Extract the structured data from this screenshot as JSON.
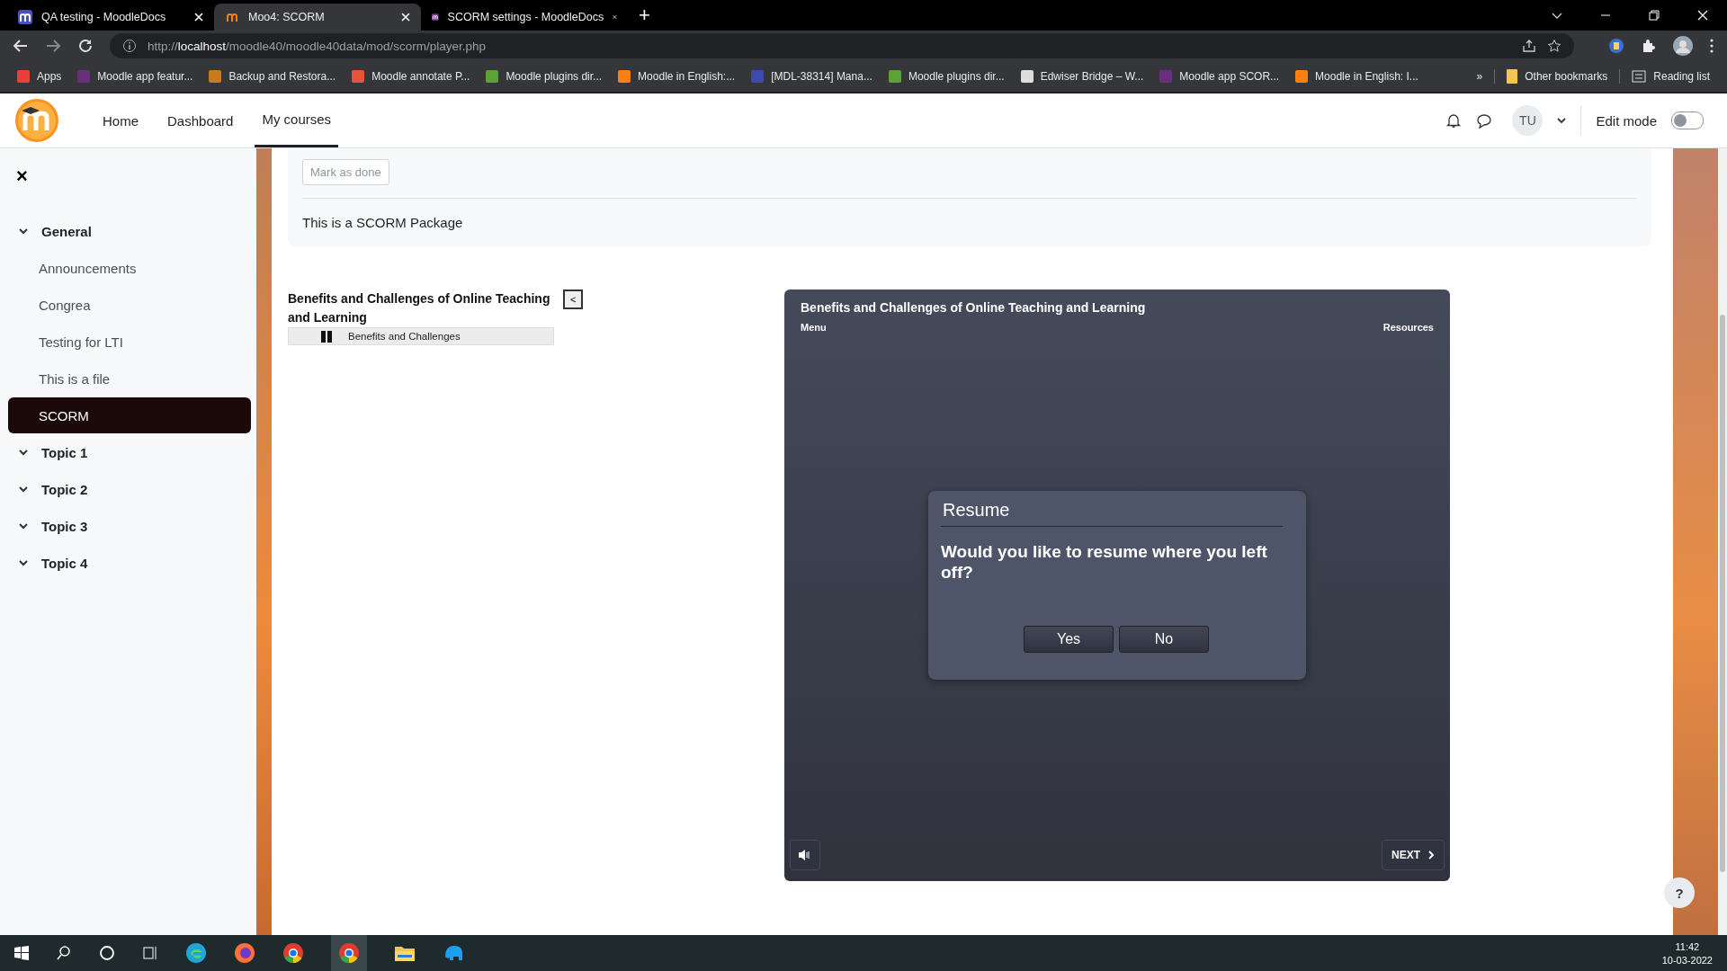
{
  "browser": {
    "tabs": [
      {
        "title": "QA testing - MoodleDocs",
        "selected": false,
        "color": "#4a4fc0"
      },
      {
        "title": "Moo4: SCORM",
        "selected": true,
        "color": "#f98012"
      },
      {
        "title": "SCORM settings - MoodleDocs",
        "selected": false,
        "color": "#7b3a8c"
      }
    ],
    "new_tab": "+",
    "url": "http://**localhost**/moodle40/moodle40data/mod/scorm/player.php",
    "bookmarks": [
      {
        "label": "Apps",
        "color": "#e94235"
      },
      {
        "label": "Moodle app featur...",
        "color": "#6a2f7c"
      },
      {
        "label": "Backup and Restora...",
        "color": "#c77b1a"
      },
      {
        "label": "Moodle annotate P...",
        "color": "#e5533c"
      },
      {
        "label": "Moodle plugins dir...",
        "color": "#5ba334"
      },
      {
        "label": "Moodle in English:...",
        "color": "#f98012"
      },
      {
        "label": "[MDL-38314] Mana...",
        "color": "#3d4bb0"
      },
      {
        "label": "Moodle plugins dir...",
        "color": "#5ba334"
      },
      {
        "label": "Edwiser Bridge – W...",
        "color": "#dddddd"
      },
      {
        "label": "Moodle app SCOR...",
        "color": "#6a2f7c"
      },
      {
        "label": "Moodle in English: I...",
        "color": "#f98012"
      }
    ],
    "more": "»",
    "other_bookmarks": "Other bookmarks",
    "reading_list": "Reading list"
  },
  "nav": {
    "items": [
      {
        "label": "Home",
        "selected": false
      },
      {
        "label": "Dashboard",
        "selected": false
      },
      {
        "label": "My courses",
        "selected": true
      }
    ],
    "user": "TU",
    "edit_mode": {
      "label": "Edit mode",
      "on": false
    }
  },
  "sidebar": {
    "close": "×",
    "items": [
      {
        "kind": "section",
        "label": "General",
        "expanded": true
      },
      {
        "kind": "activity",
        "label": "Announcements",
        "selected": false
      },
      {
        "kind": "activity",
        "label": "Congrea",
        "selected": false
      },
      {
        "kind": "activity",
        "label": "Testing for LTI",
        "selected": false
      },
      {
        "kind": "activity",
        "label": "This is a file",
        "selected": false
      },
      {
        "kind": "activity",
        "label": "SCORM",
        "selected": true
      },
      {
        "kind": "section",
        "label": "Topic 1",
        "expanded": true
      },
      {
        "kind": "section",
        "label": "Topic 2",
        "expanded": true
      },
      {
        "kind": "section",
        "label": "Topic 3",
        "expanded": true
      },
      {
        "kind": "section",
        "label": "Topic 4",
        "expanded": true
      }
    ]
  },
  "activity": {
    "mark_done": "Mark as done",
    "description": "This is a SCORM Package"
  },
  "toc": {
    "title": "Benefits and Challenges of Online Teaching and Learning",
    "toggle": "<",
    "items": [
      {
        "label": "Benefits and Challenges"
      }
    ]
  },
  "player": {
    "title": "Benefits and Challenges of Online Teaching and Learning",
    "menu": "Menu",
    "resources": "Resources",
    "dialog": {
      "title": "Resume",
      "message": "Would you like to resume where you left off?",
      "buttons": [
        "Yes",
        "No"
      ]
    },
    "next": "NEXT"
  },
  "help": "?",
  "taskbar": {
    "time": "11:42",
    "date": "10-03-2022"
  }
}
